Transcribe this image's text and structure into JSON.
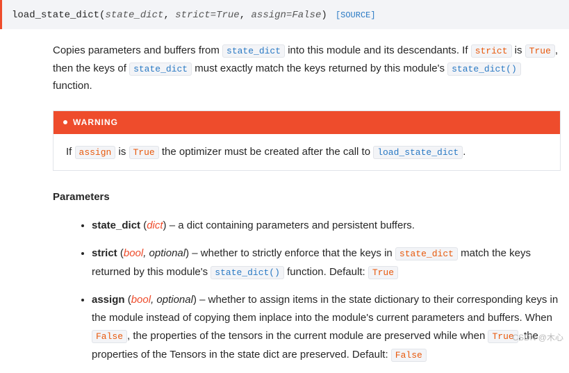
{
  "signature": {
    "name": "load_state_dict",
    "params": [
      {
        "name": "state_dict",
        "default": null
      },
      {
        "name": "strict",
        "default": "True"
      },
      {
        "name": "assign",
        "default": "False"
      }
    ],
    "source_label": "[SOURCE]"
  },
  "description": {
    "t1": "Copies parameters and buffers from ",
    "c1": "state_dict",
    "t2": " into this module and its descendants. If ",
    "c2": "strict",
    "t3": " is ",
    "c3": "True",
    "t4": ", then the keys of ",
    "c4": "state_dict",
    "t5": " must exactly match the keys returned by this module's ",
    "c5": "state_dict()",
    "t6": " function."
  },
  "warning": {
    "label": "WARNING",
    "t1": "If ",
    "c1": "assign",
    "t2": " is ",
    "c2": "True",
    "t3": " the optimizer must be created after the call to ",
    "c3": "load_state_dict",
    "t4": "."
  },
  "parameters": {
    "heading": "Parameters",
    "items": [
      {
        "name": "state_dict",
        "type": "dict",
        "optional": "",
        "desc_parts": [
          {
            "kind": "text",
            "v": " – a dict containing parameters and persistent buffers."
          }
        ]
      },
      {
        "name": "strict",
        "type": "bool",
        "optional": ", optional",
        "desc_parts": [
          {
            "kind": "text",
            "v": " – whether to strictly enforce that the keys in "
          },
          {
            "kind": "code",
            "v": "state_dict"
          },
          {
            "kind": "text",
            "v": " match the keys returned by this module's "
          },
          {
            "kind": "codelink",
            "v": "state_dict()"
          },
          {
            "kind": "text",
            "v": " function. Default: "
          },
          {
            "kind": "code",
            "v": "True"
          }
        ]
      },
      {
        "name": "assign",
        "type": "bool",
        "optional": ", optional",
        "desc_parts": [
          {
            "kind": "text",
            "v": " – whether to assign items in the state dictionary to their corresponding keys in the module instead of copying them inplace into the module's current parameters and buffers. When "
          },
          {
            "kind": "code",
            "v": "False"
          },
          {
            "kind": "text",
            "v": ", the properties of the tensors in the current module are preserved while when "
          },
          {
            "kind": "code",
            "v": "True"
          },
          {
            "kind": "text",
            "v": ", the properties of the Tensors in the state dict are preserved. Default: "
          },
          {
            "kind": "code",
            "v": "False"
          }
        ]
      }
    ]
  },
  "watermark": "CSDN @木心"
}
